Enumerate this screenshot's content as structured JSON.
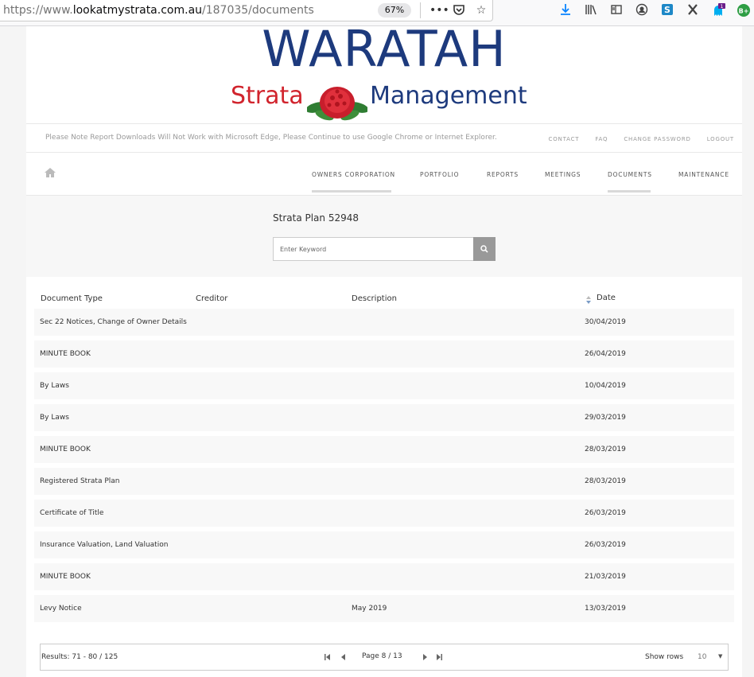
{
  "browser": {
    "url_prefix": "https://www.",
    "url_host": "lookatmystrata.com.au",
    "url_path": "/187035/documents",
    "zoom": "67%",
    "badge_count": "1"
  },
  "logo": {
    "title": "WARATAH",
    "sub_left": "Strata",
    "sub_right": "Management"
  },
  "notice": "Please Note Report Downloads Will Not Work with Microsoft Edge, Please Continue to use Google Chrome or Internet Explorer.",
  "toplinks": [
    "CONTACT",
    "FAQ",
    "CHANGE PASSWORD",
    "LOGOUT"
  ],
  "nav": {
    "items": [
      "OWNERS CORPORATION",
      "PORTFOLIO",
      "REPORTS",
      "MEETINGS",
      "DOCUMENTS",
      "MAINTENANCE"
    ]
  },
  "search": {
    "plan_title": "Strata Plan 52948",
    "placeholder": "Enter Keyword"
  },
  "table": {
    "headers": [
      "Document Type",
      "Creditor",
      "Description",
      "Date"
    ],
    "rows": [
      {
        "type": "Sec 22 Notices, Change of Owner Details",
        "creditor": "",
        "description": "",
        "date": "30/04/2019"
      },
      {
        "type": "MINUTE BOOK",
        "creditor": "",
        "description": "",
        "date": "26/04/2019"
      },
      {
        "type": "By Laws",
        "creditor": "",
        "description": "",
        "date": "10/04/2019"
      },
      {
        "type": "By Laws",
        "creditor": "",
        "description": "",
        "date": "29/03/2019"
      },
      {
        "type": "MINUTE BOOK",
        "creditor": "",
        "description": "",
        "date": "28/03/2019"
      },
      {
        "type": "Registered Strata Plan",
        "creditor": "",
        "description": "",
        "date": "28/03/2019"
      },
      {
        "type": "Certificate of Title",
        "creditor": "",
        "description": "",
        "date": "26/03/2019"
      },
      {
        "type": "Insurance Valuation, Land Valuation",
        "creditor": "",
        "description": "",
        "date": "26/03/2019"
      },
      {
        "type": "MINUTE BOOK",
        "creditor": "",
        "description": "",
        "date": "21/03/2019"
      },
      {
        "type": "Levy Notice",
        "creditor": "",
        "description": "May 2019",
        "date": "13/03/2019"
      }
    ]
  },
  "pager": {
    "results_label": "Results:",
    "results_range": "71 - 80",
    "results_sep": " / ",
    "results_total": "125",
    "page_label": "Page",
    "page_current": "8",
    "page_sep": " / ",
    "page_total": "13",
    "show_rows_label": "Show rows",
    "rows_value": "10"
  },
  "colors": {
    "logo_blue": "#1d3a7d",
    "logo_red": "#d1242d",
    "search_button": "#999999"
  }
}
